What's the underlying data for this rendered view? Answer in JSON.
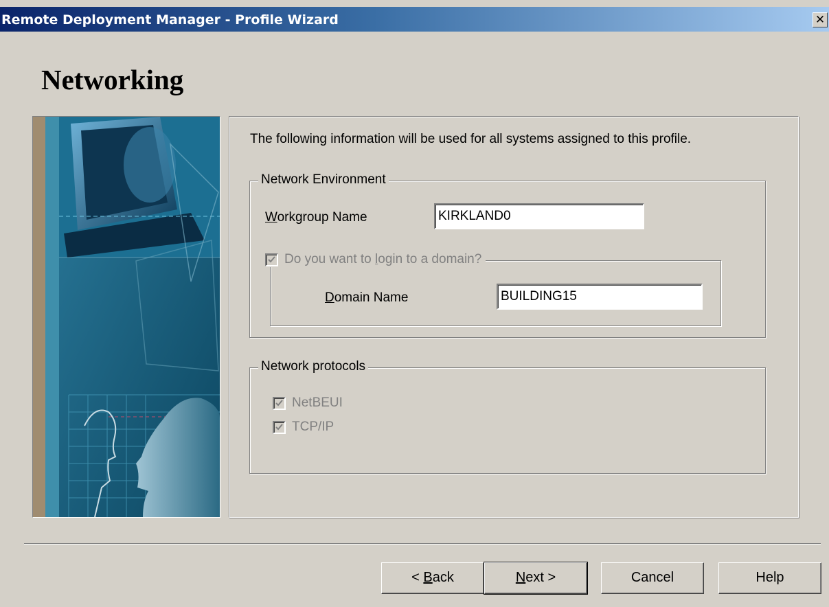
{
  "window": {
    "title": "Remote Deployment Manager - Profile Wizard",
    "close_glyph": "✕"
  },
  "page": {
    "heading": "Networking"
  },
  "intro_text": "The following information will be used for all systems assigned to this profile.",
  "network_environment": {
    "legend": "Network Environment",
    "workgroup_label": {
      "mnemonic": "W",
      "rest": "orkgroup Name"
    },
    "workgroup_value": "KIRKLAND0",
    "domain_checkbox": {
      "pre": "Do you want to ",
      "mnemonic": "l",
      "post": "ogin to a domain?",
      "checked": true,
      "enabled": false
    },
    "domain_label": {
      "mnemonic": "D",
      "rest": "omain Name"
    },
    "domain_value": "BUILDING15"
  },
  "network_protocols": {
    "legend": "Network protocols",
    "items": [
      {
        "label": "NetBEUI",
        "checked": true,
        "enabled": false
      },
      {
        "label": "TCP/IP",
        "checked": true,
        "enabled": false
      }
    ]
  },
  "buttons": {
    "back": {
      "pre": "< ",
      "mnemonic": "B",
      "post": "ack"
    },
    "next": {
      "pre": "",
      "mnemonic": "N",
      "post": "ext >"
    },
    "cancel": "Cancel",
    "help": "Help"
  },
  "icons": {
    "close": "close-icon",
    "check": "check-icon",
    "wizard_art": "wizard-art-illustration"
  },
  "colors": {
    "titlebar_start": "#0a246a",
    "titlebar_end": "#a6caf0",
    "dialog_bg": "#d4d0c8",
    "disabled_text": "#808080"
  }
}
